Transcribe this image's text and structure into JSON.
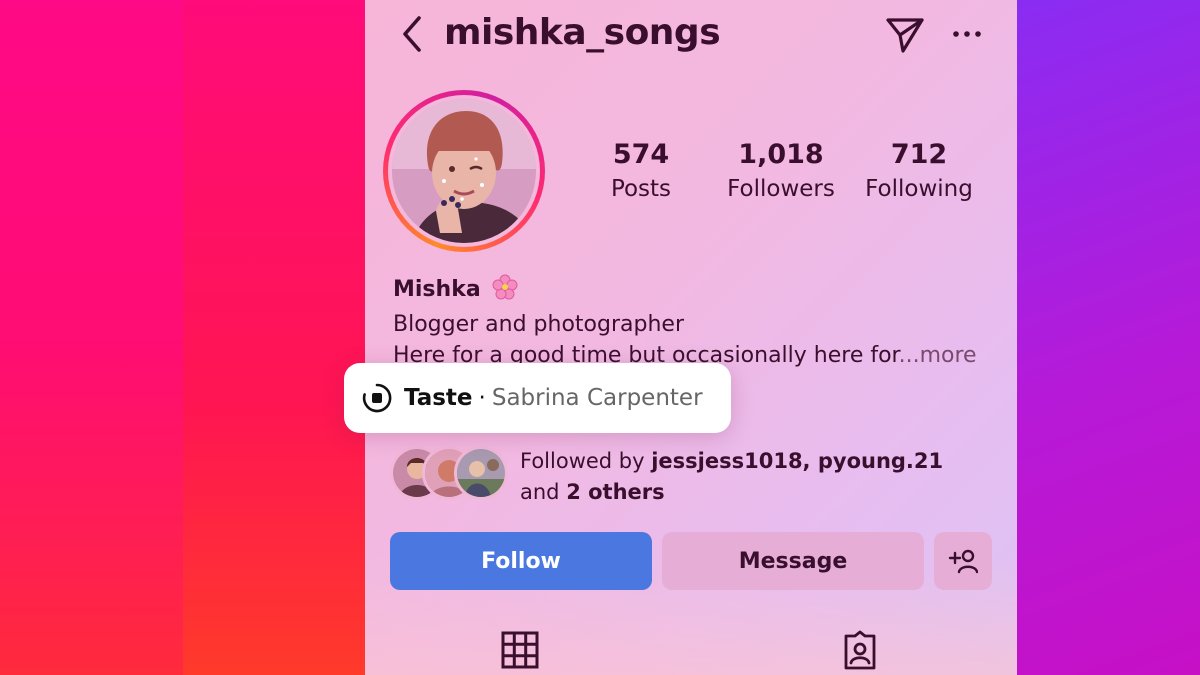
{
  "header": {
    "username": "mishka_songs"
  },
  "stats": [
    {
      "value": "574",
      "label": "Posts"
    },
    {
      "value": "1,018",
      "label": "Followers"
    },
    {
      "value": "712",
      "label": "Following"
    }
  ],
  "profile": {
    "display_name": "Mishka",
    "bio_line1": "Blogger and photographer",
    "bio_line2": "Here for a good time but occasionally here for",
    "bio_more": "...more"
  },
  "taste": {
    "brand": "Taste",
    "separator": "·",
    "artist": "Sabrina Carpenter"
  },
  "followed_by": {
    "prefix": "Followed by ",
    "names": "jessjess1018, pyoung.21",
    "and": "and ",
    "others": "2 others"
  },
  "actions": {
    "follow_label": "Follow",
    "message_label": "Message"
  },
  "icons": {
    "back": "chevron-left-icon",
    "send": "paper-plane-icon",
    "more": "more-horizontal-icon",
    "add_user": "add-user-icon",
    "grid": "grid-icon",
    "tagged": "tagged-icon",
    "taste": "record-icon",
    "flower": "cherry-blossom-icon"
  },
  "colors": {
    "follow_button": "#4a78e0",
    "text_primary": "#3a0f2e"
  }
}
